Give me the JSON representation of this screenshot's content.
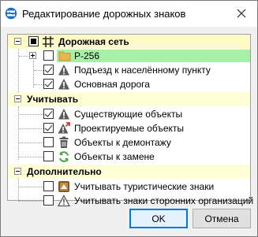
{
  "window": {
    "title": "Редактирование дорожных знаков"
  },
  "tree": {
    "road_network": {
      "label": "Дорожная сеть"
    },
    "road_item": {
      "label": "Р-256"
    },
    "approach": {
      "label": "Подъезд к населённому пункту"
    },
    "main_road": {
      "label": "Основная дорога"
    },
    "consider": {
      "label": "Учитывать"
    },
    "existing": {
      "label": "Существующие объекты"
    },
    "planned": {
      "label": "Проектируемые объекты"
    },
    "dismantle": {
      "label": "Объекты к демонтажу"
    },
    "replace": {
      "label": "Объекты к замене"
    },
    "additional": {
      "label": "Дополнительно"
    },
    "tourist": {
      "label": "Учитывать туристические знаки"
    },
    "third_party": {
      "label": "Учитывать знаки сторонних организаций"
    }
  },
  "buttons": {
    "ok": "OK",
    "cancel": "Отмена"
  },
  "colors": {
    "group_bg": "#ffffd5",
    "selected_bg": "#a7f0a7",
    "accent": "#0078d7"
  }
}
